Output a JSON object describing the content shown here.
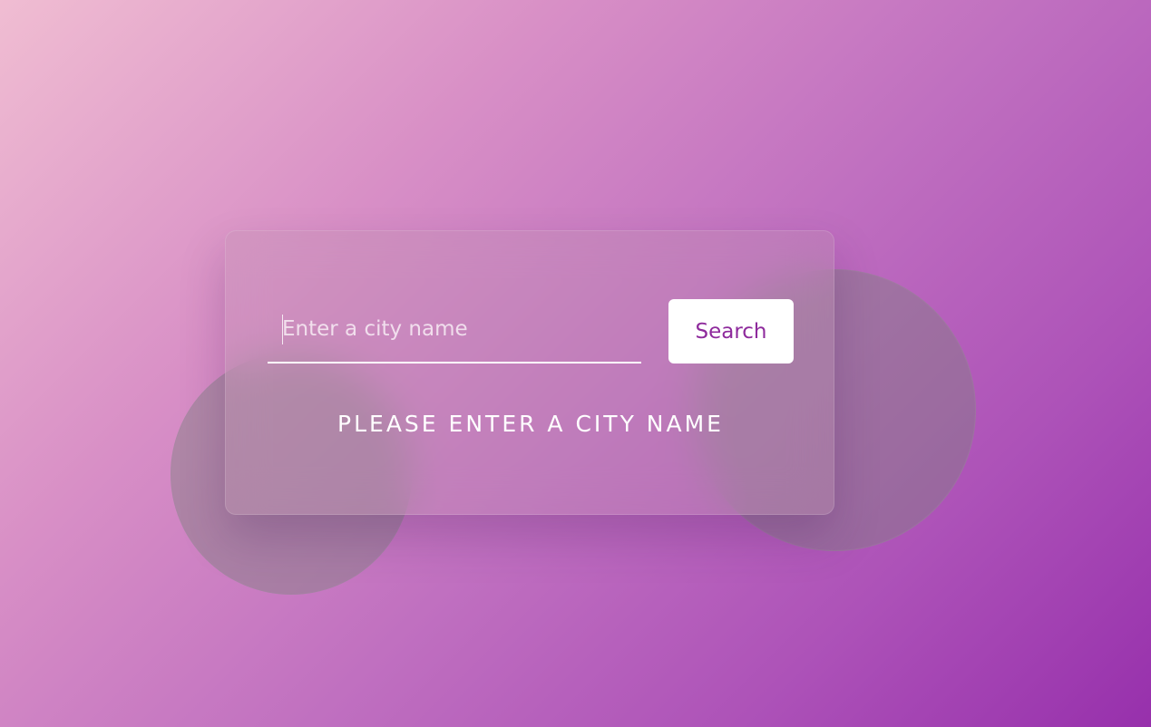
{
  "search": {
    "placeholder": "Enter a city name",
    "value": "",
    "button_label": "Search"
  },
  "status": {
    "message": "PLEASE ENTER A CITY NAME"
  },
  "colors": {
    "background_start": "#f0bdd2",
    "background_end": "#9730ac",
    "button_text": "#8e2a9c",
    "button_background": "#ffffff"
  }
}
